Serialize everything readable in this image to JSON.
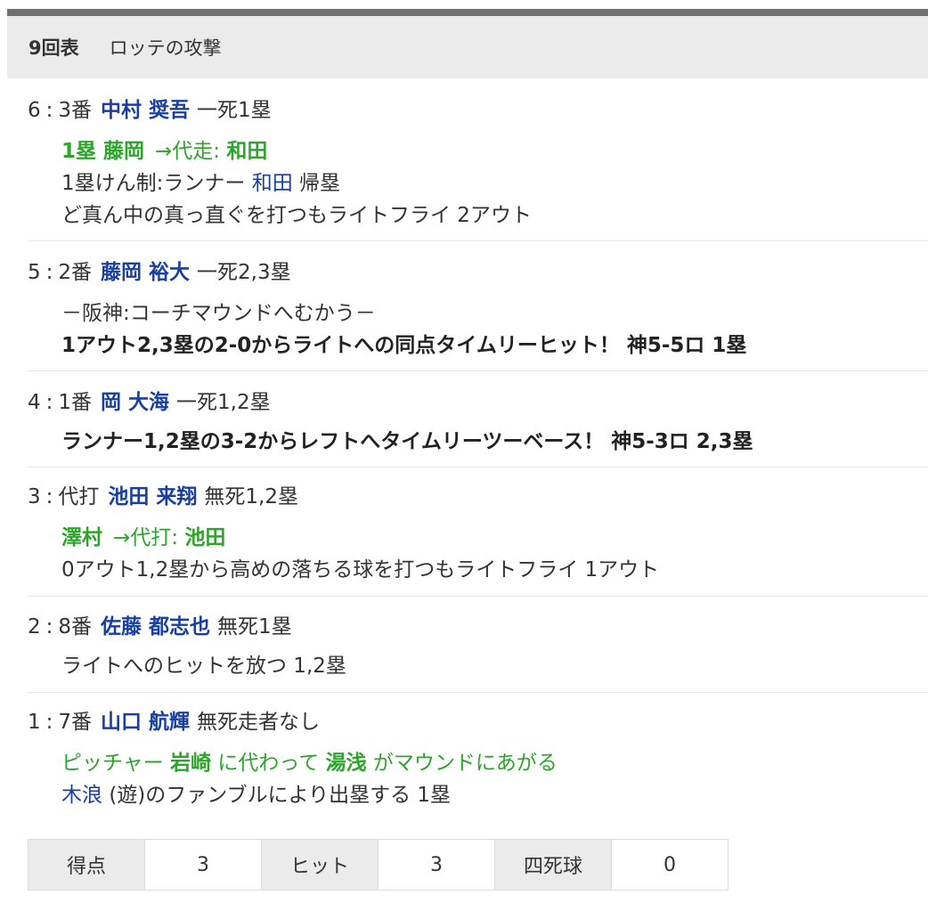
{
  "header": {
    "inning": "9回表",
    "attack": "ロッテの攻撃"
  },
  "plays": [
    {
      "num": "6",
      "order": "3番",
      "player": "中村 奨吾",
      "situation": "一死1塁",
      "sub": {
        "from": "1塁 藤岡",
        "arrow_label": "→代走:",
        "to": "和田"
      },
      "pickoff": {
        "prefix": "1塁けん制:ランナー",
        "runner": "和田",
        "suffix": "帰塁"
      },
      "result": "ど真ん中の真っ直ぐを打つもライトフライ 2アウト"
    },
    {
      "num": "5",
      "order": "2番",
      "player": "藤岡 裕大",
      "situation": "一死2,3塁",
      "note": "－阪神:コーチマウンドへむかう－",
      "result": "1アウト2,3塁の2-0からライトへの同点タイムリーヒット！ 神5-5ロ 1塁"
    },
    {
      "num": "4",
      "order": "1番",
      "player": "岡 大海",
      "situation": "一死1,2塁",
      "result": "ランナー1,2塁の3-2からレフトへタイムリーツーベース！ 神5-3ロ 2,3塁"
    },
    {
      "num": "3",
      "order": "代打",
      "player": "池田 来翔",
      "situation": "無死1,2塁",
      "sub": {
        "from": "澤村",
        "arrow_label": "→代打:",
        "to": "池田"
      },
      "result": "0アウト1,2塁から高めの落ちる球を打つもライトフライ 1アウト"
    },
    {
      "num": "2",
      "order": "8番",
      "player": "佐藤 都志也",
      "situation": "無死1塁",
      "result": "ライトへのヒットを放つ 1,2塁"
    },
    {
      "num": "1",
      "order": "7番",
      "player": "山口 航輝",
      "situation": "無死走者なし",
      "pitching_change": {
        "prefix": "ピッチャー",
        "old": "岩崎",
        "mid": "に代わって",
        "new": "湯浅",
        "suffix": "がマウンドにあがる"
      },
      "error": {
        "fielder": "木浪",
        "text": "(遊)のファンブルにより出塁する 1塁"
      }
    }
  ],
  "stats": [
    {
      "label": "得点",
      "value": "3"
    },
    {
      "label": "ヒット",
      "value": "3"
    },
    {
      "label": "四死球",
      "value": "0"
    }
  ]
}
